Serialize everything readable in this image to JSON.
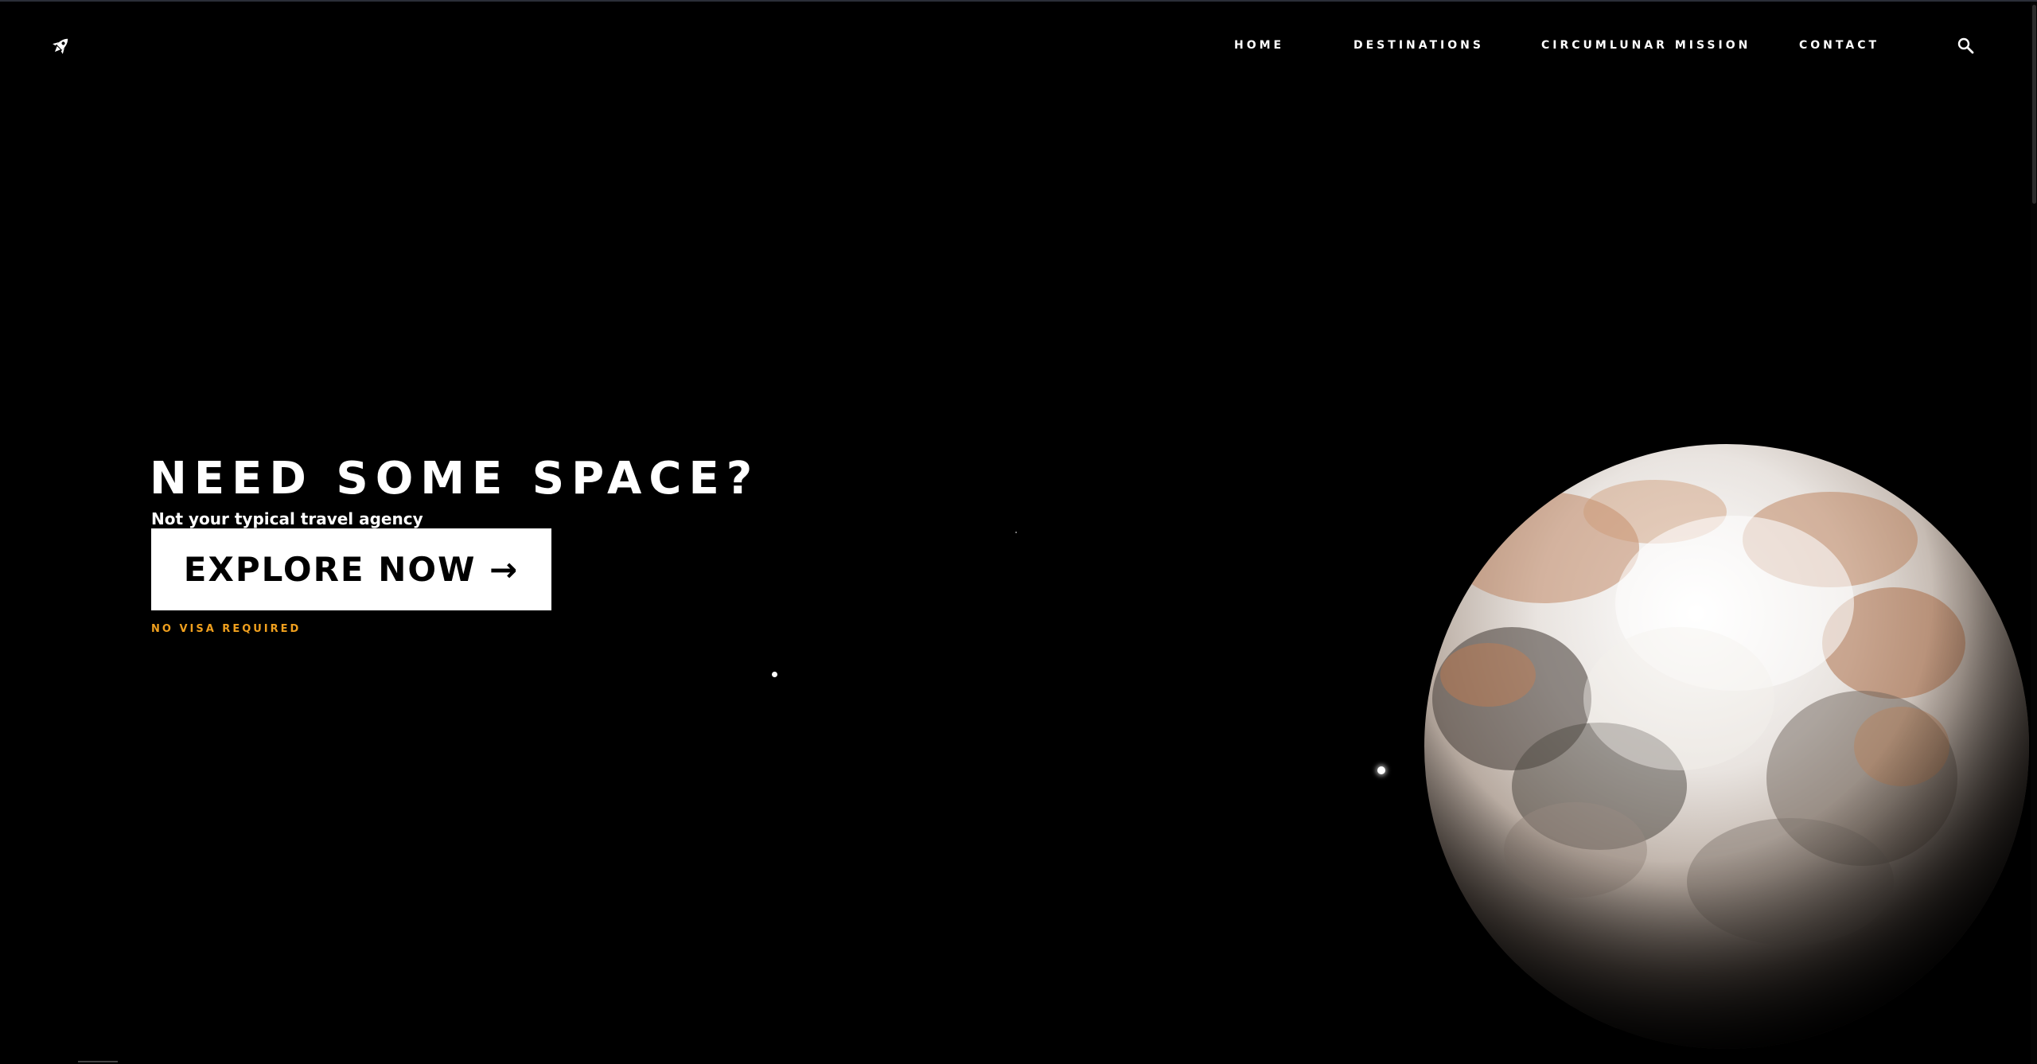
{
  "header": {
    "logo_icon": "rocket-icon",
    "nav": [
      {
        "label": "HOME"
      },
      {
        "label": "DESTINATIONS"
      },
      {
        "label": "CIRCUMLUNAR MISSION"
      },
      {
        "label": "CONTACT"
      }
    ],
    "search_icon": "search-icon"
  },
  "hero": {
    "title": "NEED SOME SPACE?",
    "subtitle": "Not your typical travel agency",
    "cta_label": "EXPLORE NOW →",
    "cta_note": "NO VISA REQUIRED"
  },
  "colors": {
    "background": "#000000",
    "text": "#ffffff",
    "accent": "#f0a01e",
    "button_bg": "#ffffff",
    "button_text": "#000000"
  }
}
